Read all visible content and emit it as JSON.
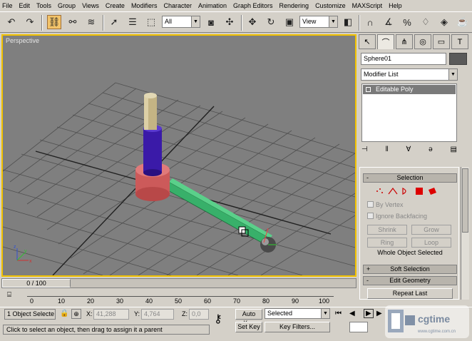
{
  "menu": [
    "File",
    "Edit",
    "Tools",
    "Group",
    "Views",
    "Create",
    "Modifiers",
    "Character",
    "Animation",
    "Graph Editors",
    "Rendering",
    "Customize",
    "MAXScript",
    "Help"
  ],
  "toolbar": {
    "selection_filter": "All",
    "ref_coord": "View",
    "icons": [
      "undo-icon",
      "redo-icon",
      "select-and-link-icon",
      "unlink-icon",
      "bind-space-warp-icon",
      "select-icon",
      "select-by-name-icon",
      "selection-region-icon",
      "select-move-icon",
      "select-rotate-icon",
      "select-scale-icon",
      "pivot-icon",
      "snap-icon",
      "mirror-icon",
      "align-icon",
      "material-editor-icon",
      "render-icon",
      "teapot-icon"
    ]
  },
  "viewport": {
    "label": "Perspective"
  },
  "command_panel": {
    "object_name": "Sphere01",
    "object_color": "#5a5a5a",
    "modifier_list": "Modifier List",
    "stack_item": "Editable Poly",
    "selection": {
      "title": "Selection",
      "by_vertex": "By Vertex",
      "ignore_backfacing": "Ignore Backfacing",
      "shrink": "Shrink",
      "grow": "Grow",
      "ring": "Ring",
      "loop": "Loop",
      "status": "Whole Object Selected"
    },
    "soft_selection": "Soft Selection",
    "edit_geometry": "Edit Geometry",
    "repeat_last": "Repeat Last",
    "rollout_minus": "-",
    "rollout_plus": "+"
  },
  "timeline": {
    "frame": "0 / 100",
    "ticks": [
      "0",
      "10",
      "20",
      "30",
      "40",
      "50",
      "60",
      "70",
      "80",
      "90",
      "100"
    ]
  },
  "status": {
    "selected": "1 Object Selecte",
    "x_label": "X:",
    "x_value": "41,288",
    "y_label": "Y:",
    "y_value": "4,764",
    "z_label": "Z:",
    "z_value": "0,0",
    "auto_key": "Auto Key",
    "key_mode": "Selected",
    "set_key": "Set Key",
    "key_filters": "Key Filters...",
    "prompt": "Click to select an object, then drag to assign it a parent"
  },
  "watermark": {
    "text": "cgtime",
    "url": "www.cgtime.com.cn"
  },
  "colors": {
    "viewport_border": "#f2c200",
    "bone_green": "#38b06a",
    "base_red": "#d05a5a",
    "shaft_blue": "#3a1aa8",
    "top_tan": "#c8b88a"
  }
}
